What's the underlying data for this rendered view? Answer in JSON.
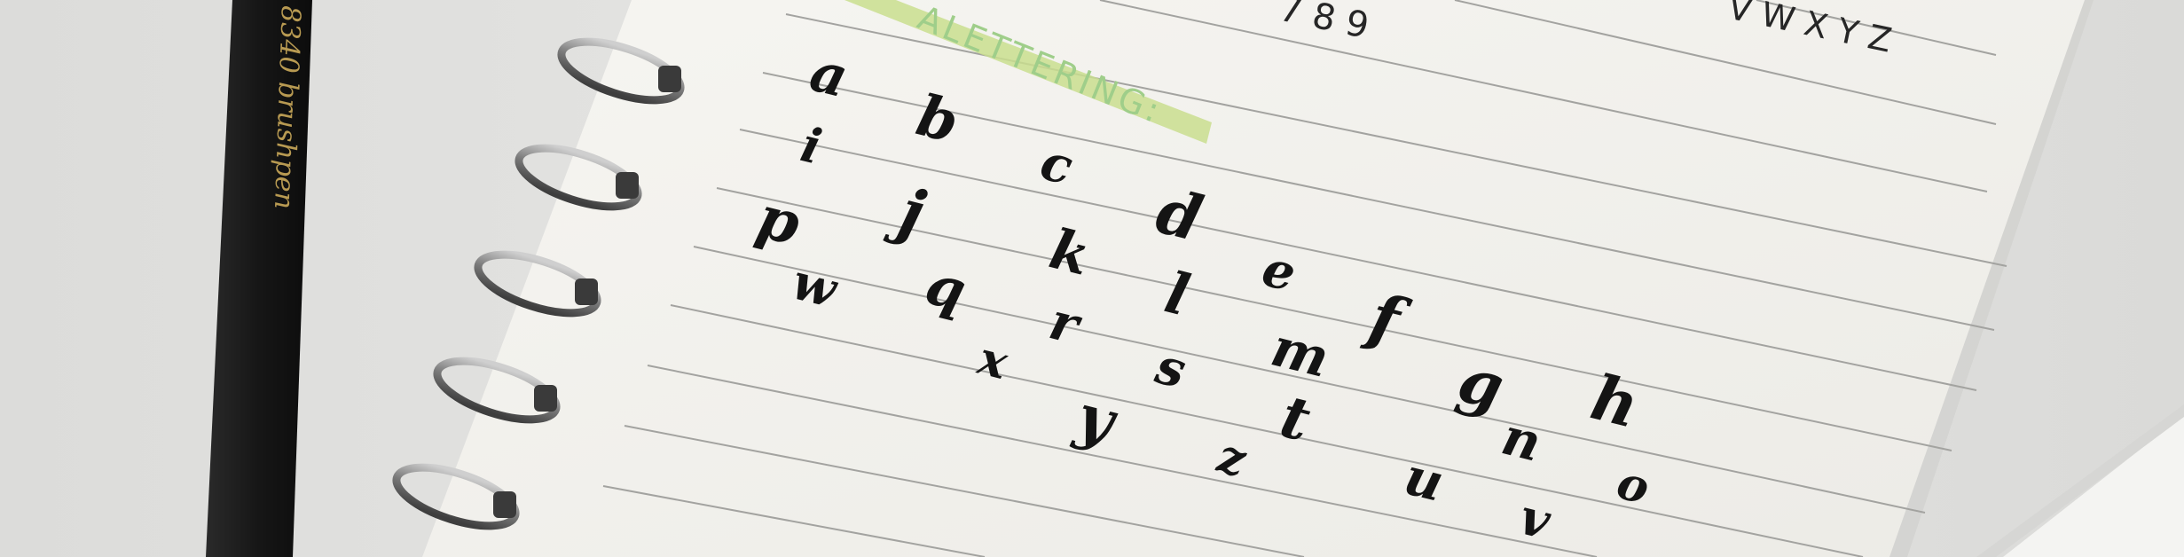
{
  "scene": {
    "description_tags": [
      "spiral-notebook",
      "brush-lettering-practice",
      "black-pencil",
      "pen"
    ],
    "colors": {
      "background": "#e4e4e2",
      "paper": "#f3f2ee",
      "ruled_line": "#9a9a98",
      "ink": "#141414",
      "highlighter": "#c9de8e",
      "pencil_body": "#1b1b1b",
      "pencil_print": "#b89a52",
      "coil": "#8c8c8c"
    }
  },
  "pencil": {
    "imprint": "8340 brushpen"
  },
  "notebook": {
    "top_printed_digits": "7 8 9",
    "top_printed_letters": "V W X Y Z",
    "heading_fragment": "ALETTERING:",
    "lettering_alphabet": [
      "a",
      "b",
      "c",
      "d",
      "e",
      "f",
      "g",
      "h",
      "i",
      "j",
      "k",
      "l",
      "m",
      "n",
      "o",
      "p",
      "q",
      "r",
      "s",
      "t",
      "u",
      "v",
      "w",
      "x",
      "y",
      "z"
    ]
  }
}
